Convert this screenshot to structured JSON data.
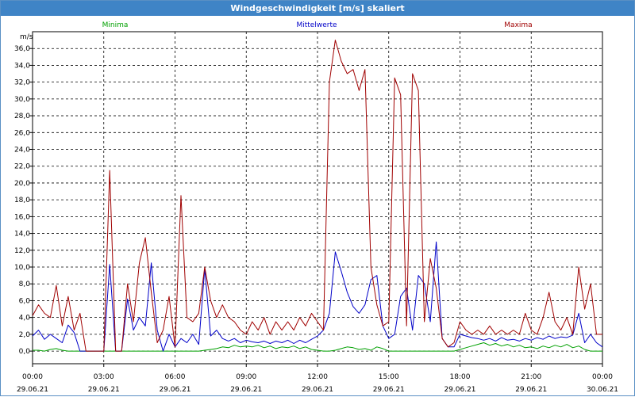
{
  "window": {
    "title": "Windgeschwindigkeit [m/s] skaliert"
  },
  "colors": {
    "minima": "#00a000",
    "mittelwerte": "#0000c8",
    "maxima": "#a00000",
    "grid": "#000000",
    "titlebar": "#3f84c6"
  },
  "chart_data": {
    "type": "line",
    "title": "Windgeschwindigkeit [m/s] skaliert",
    "ylabel": "m/s",
    "xlabel": "",
    "ylim": [
      -1.5,
      38.0
    ],
    "xlim_hours": [
      0,
      24
    ],
    "grid": true,
    "legend_placement": "top",
    "y_ticks": [
      "0,0",
      "2,0",
      "4,0",
      "6,0",
      "8,0",
      "10,0",
      "12,0",
      "14,0",
      "16,0",
      "18,0",
      "20,0",
      "22,0",
      "24,0",
      "26,0",
      "28,0",
      "30,0",
      "32,0",
      "34,0",
      "36,0"
    ],
    "x_ticks": [
      {
        "time": "00:00",
        "date": "29.06.21"
      },
      {
        "time": "03:00",
        "date": "29.06.21"
      },
      {
        "time": "06:00",
        "date": "29.06.21"
      },
      {
        "time": "09:00",
        "date": "29.06.21"
      },
      {
        "time": "12:00",
        "date": "29.06.21"
      },
      {
        "time": "15:00",
        "date": "29.06.21"
      },
      {
        "time": "18:00",
        "date": "29.06.21"
      },
      {
        "time": "21:00",
        "date": "29.06.21"
      },
      {
        "time": "00:00",
        "date": "30.06.21"
      }
    ],
    "x": [
      0.0,
      0.25,
      0.5,
      0.75,
      1.0,
      1.25,
      1.5,
      1.75,
      2.0,
      2.25,
      2.5,
      2.75,
      3.0,
      3.25,
      3.5,
      3.75,
      4.0,
      4.25,
      4.5,
      4.75,
      5.0,
      5.25,
      5.5,
      5.75,
      6.0,
      6.25,
      6.5,
      6.75,
      7.0,
      7.25,
      7.5,
      7.75,
      8.0,
      8.25,
      8.5,
      8.75,
      9.0,
      9.25,
      9.5,
      9.75,
      10.0,
      10.25,
      10.5,
      10.75,
      11.0,
      11.25,
      11.5,
      11.75,
      12.0,
      12.25,
      12.5,
      12.75,
      13.0,
      13.25,
      13.5,
      13.75,
      14.0,
      14.25,
      14.5,
      14.75,
      15.0,
      15.25,
      15.5,
      15.75,
      16.0,
      16.25,
      16.5,
      16.75,
      17.0,
      17.25,
      17.5,
      17.75,
      18.0,
      18.25,
      18.5,
      18.75,
      19.0,
      19.25,
      19.5,
      19.75,
      20.0,
      20.25,
      20.5,
      20.75,
      21.0,
      21.25,
      21.5,
      21.75,
      22.0,
      22.25,
      22.5,
      22.75,
      23.0,
      23.25,
      23.5,
      23.75,
      24.0
    ],
    "series": [
      {
        "name": "Minima",
        "values": [
          0.1,
          0.1,
          0.0,
          0.2,
          0.3,
          0.1,
          0.0,
          0.0,
          0.0,
          0.0,
          0.0,
          0.0,
          0.0,
          0.0,
          0.0,
          0.0,
          0.0,
          0.0,
          0.0,
          0.0,
          0.0,
          0.0,
          0.0,
          0.0,
          0.0,
          0.0,
          0.0,
          0.0,
          0.0,
          0.1,
          0.2,
          0.3,
          0.5,
          0.4,
          0.7,
          0.5,
          0.6,
          0.5,
          0.7,
          0.4,
          0.6,
          0.3,
          0.5,
          0.4,
          0.6,
          0.3,
          0.5,
          0.2,
          0.1,
          0.0,
          0.0,
          0.1,
          0.3,
          0.5,
          0.4,
          0.2,
          0.3,
          0.1,
          0.5,
          0.3,
          0.0,
          0.0,
          0.0,
          0.0,
          0.0,
          0.0,
          0.0,
          0.0,
          0.0,
          0.0,
          0.0,
          0.0,
          0.2,
          0.4,
          0.6,
          0.8,
          1.0,
          0.7,
          0.9,
          0.6,
          0.8,
          0.5,
          0.7,
          0.4,
          0.5,
          0.3,
          0.6,
          0.4,
          0.7,
          0.5,
          0.8,
          0.4,
          0.6,
          0.2,
          0.0,
          0.0,
          0.0
        ]
      },
      {
        "name": "Mittelwerte",
        "values": [
          1.8,
          2.5,
          1.4,
          2.0,
          1.5,
          1.0,
          3.1,
          2.2,
          0.0,
          0.0,
          0.0,
          0.0,
          0.0,
          10.3,
          0.0,
          0.0,
          6.2,
          2.5,
          4.0,
          3.0,
          10.5,
          2.5,
          0.0,
          2.0,
          0.5,
          1.5,
          1.0,
          2.0,
          0.8,
          9.8,
          1.8,
          2.5,
          1.5,
          1.2,
          1.5,
          1.0,
          1.3,
          1.1,
          1.0,
          1.2,
          0.9,
          1.2,
          1.0,
          1.3,
          0.9,
          1.3,
          1.0,
          1.4,
          1.8,
          2.5,
          4.5,
          11.8,
          9.5,
          7.0,
          5.3,
          4.5,
          5.5,
          8.5,
          9.0,
          3.0,
          1.5,
          2.0,
          6.5,
          7.5,
          2.5,
          9.0,
          8.0,
          3.5,
          13.0,
          1.5,
          0.5,
          0.5,
          2.0,
          1.8,
          1.6,
          1.5,
          1.3,
          1.5,
          1.2,
          1.6,
          1.3,
          1.4,
          1.2,
          1.5,
          1.3,
          1.6,
          1.4,
          1.8,
          1.5,
          1.7,
          1.6,
          1.9,
          4.5,
          1.0,
          2.0,
          1.0,
          0.5
        ]
      },
      {
        "name": "Maxima",
        "values": [
          4.2,
          5.5,
          4.5,
          4.0,
          7.8,
          3.0,
          6.5,
          2.5,
          4.5,
          0.0,
          0.0,
          0.0,
          0.0,
          21.5,
          0.0,
          0.0,
          8.0,
          3.5,
          10.5,
          13.5,
          7.0,
          1.0,
          2.5,
          6.5,
          0.5,
          18.5,
          4.0,
          3.5,
          4.5,
          10.0,
          6.0,
          4.0,
          5.5,
          4.0,
          3.5,
          2.5,
          2.0,
          3.5,
          2.5,
          4.0,
          2.0,
          3.5,
          2.5,
          3.5,
          2.5,
          4.0,
          3.0,
          4.5,
          3.5,
          2.5,
          32.0,
          37.0,
          34.5,
          33.0,
          33.5,
          31.0,
          33.5,
          10.0,
          5.5,
          3.0,
          3.5,
          32.5,
          30.5,
          3.0,
          33.0,
          31.0,
          3.5,
          11.0,
          7.5,
          1.5,
          0.5,
          1.0,
          3.5,
          2.5,
          2.0,
          2.5,
          2.0,
          3.0,
          2.0,
          2.5,
          2.0,
          2.5,
          2.0,
          4.5,
          2.5,
          2.0,
          4.0,
          7.0,
          3.5,
          2.5,
          4.0,
          2.0,
          10.0,
          5.0,
          8.0,
          2.0,
          2.0
        ]
      }
    ]
  }
}
